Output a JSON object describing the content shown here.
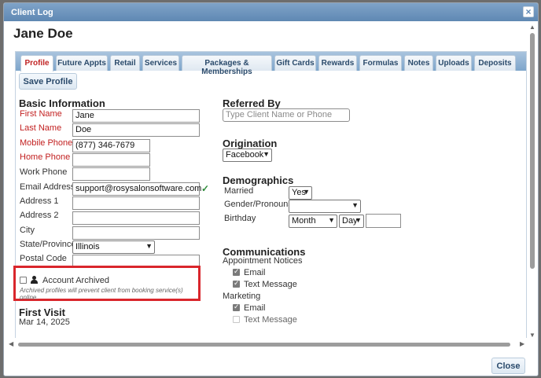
{
  "window": {
    "title": "Client Log",
    "close_glyph": "×"
  },
  "client": {
    "name": "Jane Doe"
  },
  "tabs": [
    {
      "label": "Profile"
    },
    {
      "label": "Future Appts"
    },
    {
      "label": "Retail"
    },
    {
      "label": "Services"
    },
    {
      "label": "Packages & Memberships"
    },
    {
      "label": "Gift Cards"
    },
    {
      "label": "Rewards"
    },
    {
      "label": "Formulas"
    },
    {
      "label": "Notes"
    },
    {
      "label": "Uploads"
    },
    {
      "label": "Deposits"
    }
  ],
  "toolbar": {
    "save_label": "Save Profile"
  },
  "basic": {
    "title": "Basic Information",
    "first_name": {
      "label": "First Name",
      "value": "Jane"
    },
    "last_name": {
      "label": "Last Name",
      "value": "Doe"
    },
    "mobile_phone": {
      "label": "Mobile Phone",
      "value": "(877) 346-7679"
    },
    "home_phone": {
      "label": "Home Phone",
      "value": ""
    },
    "work_phone": {
      "label": "Work Phone",
      "value": ""
    },
    "email": {
      "label": "Email Address",
      "value": "support@rosysalonsoftware.com"
    },
    "address1": {
      "label": "Address 1",
      "value": ""
    },
    "address2": {
      "label": "Address 2",
      "value": ""
    },
    "city": {
      "label": "City",
      "value": ""
    },
    "state": {
      "label": "State/Province",
      "value": "Illinois"
    },
    "postal": {
      "label": "Postal Code",
      "value": ""
    }
  },
  "archive": {
    "label": "Account Archived",
    "note": "Archived profiles will prevent client from booking service(s) online.",
    "checked": false
  },
  "first_visit": {
    "title": "First Visit",
    "date": "Mar 14, 2025"
  },
  "referred": {
    "title": "Referred By",
    "placeholder": "Type Client Name or Phone"
  },
  "origination": {
    "title": "Origination",
    "value": "Facebook"
  },
  "demographics": {
    "title": "Demographics",
    "married": {
      "label": "Married",
      "value": "Yes"
    },
    "gender": {
      "label": "Gender/Pronouns",
      "value": ""
    },
    "birthday": {
      "label": "Birthday",
      "month": "Month",
      "day": "Day",
      "year": ""
    }
  },
  "communications": {
    "title": "Communications",
    "appointment": {
      "label": "Appointment Notices",
      "email": "Email",
      "text": "Text Message"
    },
    "marketing": {
      "label": "Marketing",
      "email": "Email",
      "text": "Text Message"
    }
  },
  "footer": {
    "close_label": "Close"
  },
  "icons": {
    "check": "check-icon",
    "user": "user-icon"
  },
  "colors": {
    "required_label": "#c21f1f",
    "active_tab": "#c02424",
    "highlight_box": "#d9262c",
    "valid_check": "#2e8b3a"
  }
}
